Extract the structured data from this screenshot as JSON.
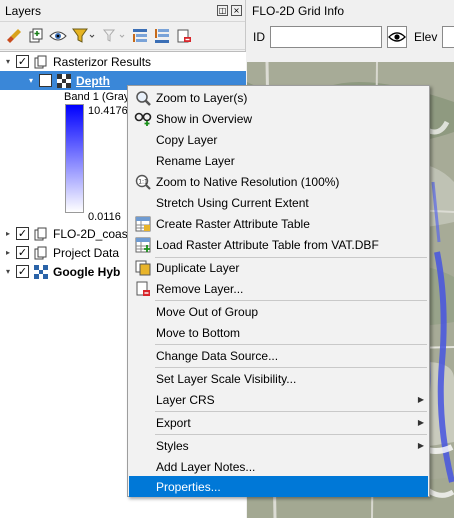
{
  "layers_panel": {
    "title": "Layers",
    "float_button": "◫",
    "close_button": "×",
    "toolbar_icons": [
      "paintbrush-icon",
      "add-group-icon",
      "eye-icon",
      "filter-icon",
      "filter-legend-icon",
      "expand-all-icon",
      "collapse-all-icon",
      "remove-layer-icon"
    ]
  },
  "tree": {
    "rasterizor": {
      "label": "Rasterizor Results",
      "checked": "✓"
    },
    "depth": {
      "label": "Depth",
      "checked": "✓"
    },
    "band_label": "Band 1 (Gray)",
    "max_value": "10.4176",
    "min_value": "0.0116",
    "flo2d_coast": {
      "label": "FLO-2D_coas",
      "checked": "✓"
    },
    "project_data": {
      "label": "Project Data",
      "checked": "✓"
    },
    "google_hybrid": {
      "label": "Google Hyb",
      "checked": "✓"
    }
  },
  "grid_info": {
    "title": "FLO-2D Grid Info",
    "id_label": "ID",
    "id_value": "",
    "elev_label": "Elev",
    "elev_value": ""
  },
  "context_menu": {
    "zoom_to_layer": "Zoom to Layer(s)",
    "show_in_overview": "Show in Overview",
    "copy_layer": "Copy Layer",
    "rename_layer": "Rename Layer",
    "zoom_native": "Zoom to Native Resolution (100%)",
    "stretch_extent": "Stretch Using Current Extent",
    "create_rat": "Create Raster Attribute Table",
    "load_rat": "Load Raster Attribute Table from VAT.DBF",
    "duplicate_layer": "Duplicate Layer",
    "remove_layer": "Remove Layer...",
    "move_out_group": "Move Out of Group",
    "move_to_bottom": "Move to Bottom",
    "change_source": "Change Data Source...",
    "scale_visibility": "Set Layer Scale Visibility...",
    "layer_crs": "Layer CRS",
    "export": "Export",
    "styles": "Styles",
    "add_notes": "Add Layer Notes...",
    "properties": "Properties..."
  },
  "colors": {
    "selection": "#3a87d8",
    "menu_highlight": "#0078d7",
    "ramp_top": "#0000ff",
    "ramp_bottom": "#ffffff"
  }
}
